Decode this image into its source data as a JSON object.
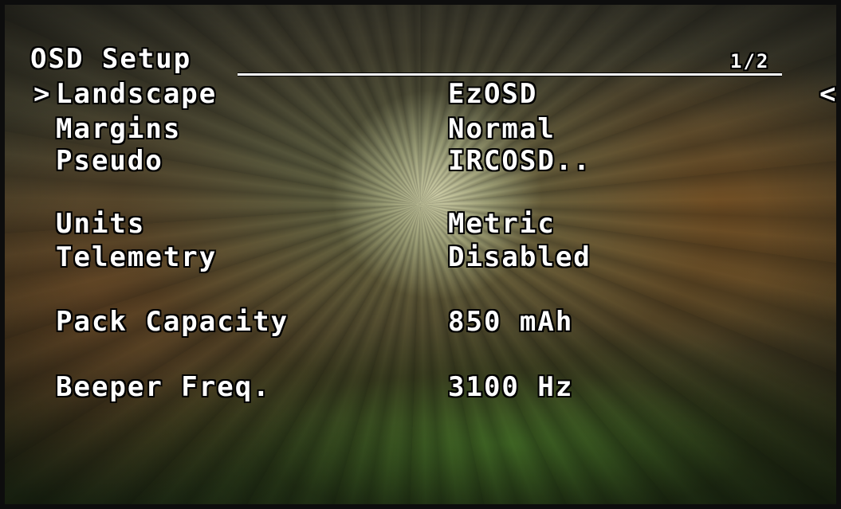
{
  "osd": {
    "title": "OSD Setup",
    "page_indicator": "1/2",
    "cursor_glyph": ">",
    "back_glyph": "<",
    "items": [
      {
        "label": "Landscape",
        "value": "EzOSD"
      },
      {
        "label": "Margins",
        "value": "Normal"
      },
      {
        "label": "Pseudo",
        "value": "IRCOSD.."
      },
      {
        "label": "Units",
        "value": "Metric"
      },
      {
        "label": "Telemetry",
        "value": "Disabled"
      },
      {
        "label": "Pack Capacity",
        "value": "850 mAh"
      },
      {
        "label": "Beeper Freq.",
        "value": "3100 Hz"
      }
    ]
  },
  "icons": {
    "selection_cursor": "chevron-right-icon",
    "back": "chevron-left-icon"
  },
  "colors": {
    "text": "#ffffff",
    "outline": "#000000"
  }
}
